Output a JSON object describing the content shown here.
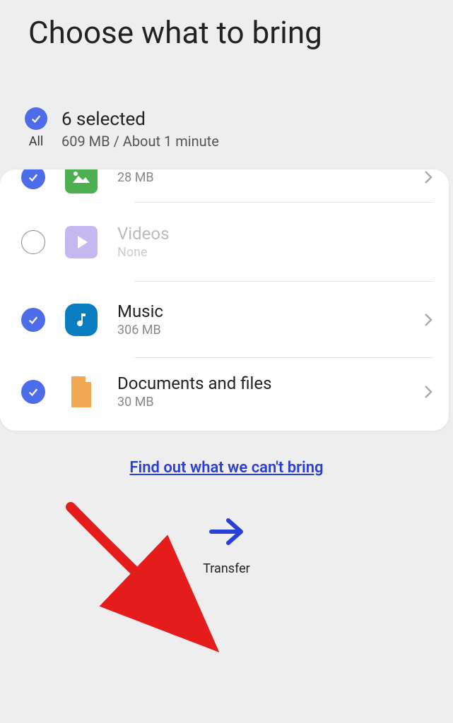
{
  "header": {
    "title": "Choose what to bring"
  },
  "summary": {
    "all_label": "All",
    "selected_count": "6 selected",
    "size_time": "609 MB / About 1 minute"
  },
  "items": [
    {
      "id": "images",
      "title": "",
      "sub": "28 MB",
      "checked": true,
      "dim": false
    },
    {
      "id": "videos",
      "title": "Videos",
      "sub": "None",
      "checked": false,
      "dim": true
    },
    {
      "id": "music",
      "title": "Music",
      "sub": "306 MB",
      "checked": true,
      "dim": false
    },
    {
      "id": "docs",
      "title": "Documents and files",
      "sub": "30 MB",
      "checked": true,
      "dim": false
    }
  ],
  "link": {
    "label": "Find out what we can't bring"
  },
  "transfer": {
    "label": "Transfer"
  }
}
